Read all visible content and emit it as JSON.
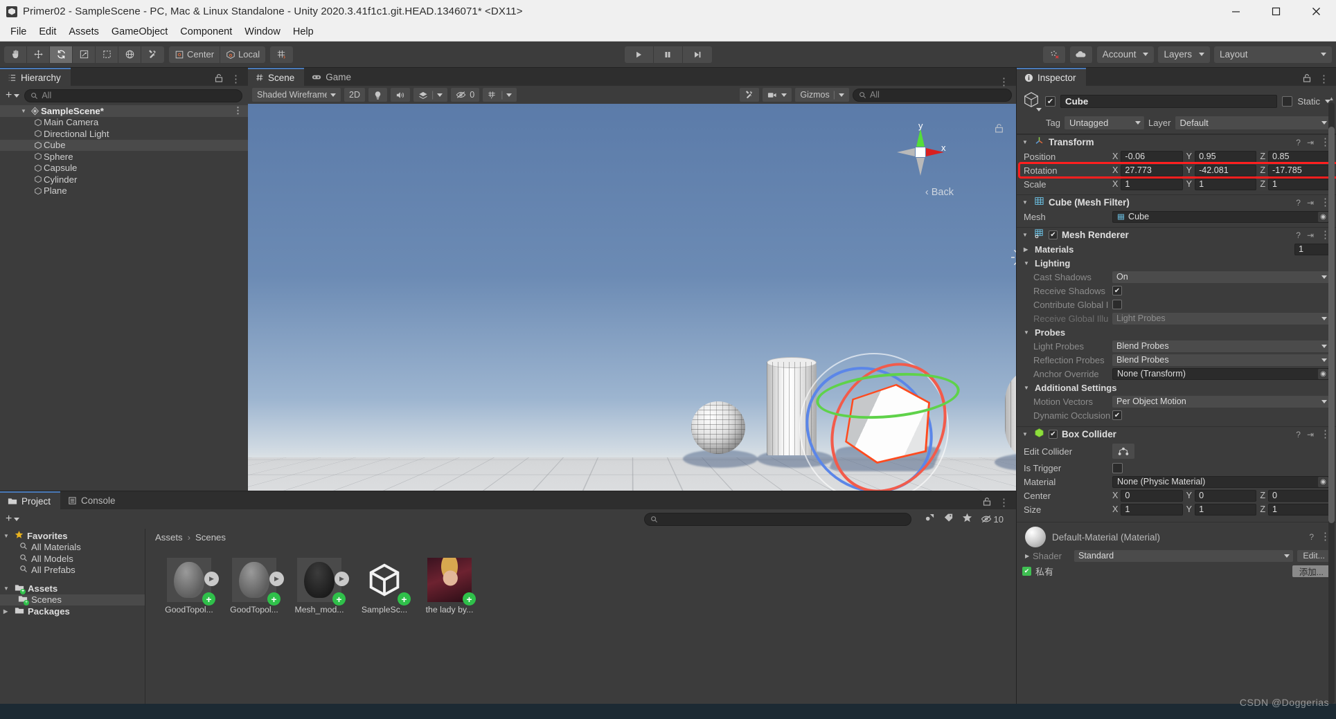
{
  "window": {
    "title": "Primer02 - SampleScene - PC, Mac & Linux Standalone - Unity 2020.3.41f1c1.git.HEAD.1346071* <DX11>",
    "icon": "unity-icon",
    "minimize": "minimize-icon",
    "maximize": "maximize-icon",
    "close": "close-icon"
  },
  "menubar": [
    "File",
    "Edit",
    "Assets",
    "GameObject",
    "Component",
    "Window",
    "Help"
  ],
  "toolbar": {
    "tools": [
      {
        "name": "hand-tool",
        "glyph": "hand",
        "active": false
      },
      {
        "name": "move-tool",
        "glyph": "move",
        "active": false
      },
      {
        "name": "rotate-tool",
        "glyph": "rotate",
        "active": true
      },
      {
        "name": "scale-tool",
        "glyph": "scale",
        "active": false
      },
      {
        "name": "rect-tool",
        "glyph": "rect",
        "active": false
      },
      {
        "name": "transform-tool",
        "glyph": "transform",
        "active": false
      },
      {
        "name": "custom-tool",
        "glyph": "wrench",
        "active": false
      }
    ],
    "pivot_mode": "Center",
    "pivot_rotation": "Local",
    "snap": "grid-snap-icon",
    "play": "play-icon",
    "pause": "pause-icon",
    "step": "step-icon",
    "collab": "collab-icon",
    "cloud": "cloud-icon",
    "account": "Account",
    "layers": "Layers",
    "layout": "Layout"
  },
  "hierarchy": {
    "tab": "Hierarchy",
    "search_placeholder": "All",
    "scene": "SampleScene*",
    "items": [
      {
        "label": "Main Camera",
        "selected": false
      },
      {
        "label": "Directional Light",
        "selected": false
      },
      {
        "label": "Cube",
        "selected": true
      },
      {
        "label": "Sphere",
        "selected": false
      },
      {
        "label": "Capsule",
        "selected": false
      },
      {
        "label": "Cylinder",
        "selected": false
      },
      {
        "label": "Plane",
        "selected": false
      }
    ]
  },
  "scene_view": {
    "tabs": [
      {
        "label": "Scene",
        "selected": true,
        "icon": "scene-icon"
      },
      {
        "label": "Game",
        "selected": false,
        "icon": "game-icon"
      }
    ],
    "draw_mode": "Shaded Wireframe",
    "mode_2d": "2D",
    "lighting": "lighting-icon",
    "audio": "audio-icon",
    "fx": "fx-icon",
    "hidden_count": "0",
    "grid": "grid-icon",
    "gizmos": "Gizmos",
    "search_placeholder": "All",
    "orientation_label": "Back",
    "axis_y": "y",
    "axis_x": "x",
    "lock": "lock-icon"
  },
  "project": {
    "tabs": [
      {
        "label": "Project",
        "selected": true,
        "icon": "folder-icon"
      },
      {
        "label": "Console",
        "selected": false,
        "icon": "console-icon"
      }
    ],
    "search_placeholder": "",
    "hidden_assets_count": "10",
    "tree": [
      {
        "label": "Favorites",
        "type": "star",
        "depth": 0,
        "expanded": true,
        "selected": false
      },
      {
        "label": "All Materials",
        "type": "search",
        "depth": 1,
        "selected": false
      },
      {
        "label": "All Models",
        "type": "search",
        "depth": 1,
        "selected": false
      },
      {
        "label": "All Prefabs",
        "type": "search",
        "depth": 1,
        "selected": false
      },
      {
        "label": "Assets",
        "type": "folder-add",
        "depth": 0,
        "expanded": true,
        "selected": false
      },
      {
        "label": "Scenes",
        "type": "folder-add",
        "depth": 1,
        "selected": true
      },
      {
        "label": "Packages",
        "type": "folder",
        "depth": 0,
        "expanded": false,
        "selected": false
      }
    ],
    "breadcrumb": [
      "Assets",
      "Scenes"
    ],
    "assets": [
      {
        "label": "GoodTopol...",
        "kind": "head",
        "play": true
      },
      {
        "label": "GoodTopol...",
        "kind": "head",
        "play": true
      },
      {
        "label": "Mesh_mod...",
        "kind": "head-dark",
        "play": true
      },
      {
        "label": "SampleSc...",
        "kind": "unity",
        "play": false
      },
      {
        "label": "the lady by...",
        "kind": "image",
        "play": false
      }
    ]
  },
  "inspector": {
    "tab": "Inspector",
    "object_name": "Cube",
    "enabled": true,
    "static_label": "Static",
    "tag_label": "Tag",
    "tag_value": "Untagged",
    "layer_label": "Layer",
    "layer_value": "Default",
    "components": [
      {
        "name": "Transform",
        "icon": "transform-icon",
        "rows": [
          {
            "label": "Position",
            "type": "vec3",
            "x": "-0.06",
            "y": "0.95",
            "z": "0.85"
          },
          {
            "label": "Rotation",
            "type": "vec3",
            "x": "27.773",
            "y": "-42.081",
            "z": "-17.785",
            "highlighted": true
          },
          {
            "label": "Scale",
            "type": "vec3",
            "x": "1",
            "y": "1",
            "z": "1"
          }
        ]
      },
      {
        "name": "Cube (Mesh Filter)",
        "icon": "mesh-filter-icon",
        "rows": [
          {
            "label": "Mesh",
            "type": "object",
            "value": "Cube"
          }
        ]
      },
      {
        "name": "Mesh Renderer",
        "icon": "mesh-renderer-icon",
        "checkbox": true,
        "rows": [
          {
            "label": "Materials",
            "type": "group-num",
            "value": "1"
          },
          {
            "label": "Lighting",
            "type": "group"
          },
          {
            "label": "Cast Shadows",
            "type": "dropdown",
            "value": "On",
            "indent": true
          },
          {
            "label": "Receive Shadows",
            "type": "check",
            "value": true,
            "indent": true
          },
          {
            "label": "Contribute Global I",
            "type": "check",
            "value": false,
            "indent": true
          },
          {
            "label": "Receive Global Illu",
            "type": "dropdown",
            "value": "Light Probes",
            "indent": true,
            "dim": true
          },
          {
            "label": "Probes",
            "type": "group"
          },
          {
            "label": "Light Probes",
            "type": "dropdown",
            "value": "Blend Probes",
            "indent": true
          },
          {
            "label": "Reflection Probes",
            "type": "dropdown",
            "value": "Blend Probes",
            "indent": true
          },
          {
            "label": "Anchor Override",
            "type": "object",
            "value": "None (Transform)",
            "indent": true
          },
          {
            "label": "Additional Settings",
            "type": "group"
          },
          {
            "label": "Motion Vectors",
            "type": "dropdown",
            "value": "Per Object Motion",
            "indent": true
          },
          {
            "label": "Dynamic Occlusion",
            "type": "check",
            "value": true,
            "indent": true
          }
        ]
      },
      {
        "name": "Box Collider",
        "icon": "box-collider-icon",
        "checkbox": true,
        "rows": [
          {
            "label": "Edit Collider",
            "type": "button",
            "value": "edit-collider-icon"
          },
          {
            "label": "Is Trigger",
            "type": "check",
            "value": false
          },
          {
            "label": "Material",
            "type": "object",
            "value": "None (Physic Material)"
          },
          {
            "label": "Center",
            "type": "vec3",
            "x": "0",
            "y": "0",
            "z": "0"
          },
          {
            "label": "Size",
            "type": "vec3",
            "x": "1",
            "y": "1",
            "z": "1"
          }
        ]
      }
    ],
    "material": {
      "title": "Default-Material (Material)",
      "shader_label": "Shader",
      "shader_value": "Standard",
      "edit_button": "Edit...",
      "private_label": "私有",
      "add_button": "添加..."
    }
  },
  "watermark": "CSDN @Doggerias",
  "colors": {
    "accent": "#4a7ab8",
    "highlight": "#ff1f1f",
    "axis_x": "#f25b4b",
    "axis_y": "#5fd24a",
    "axis_z": "#5b86e8",
    "selection_outline": "#ff4b1f",
    "panel_bg": "#3c3c3c",
    "toolbar_bg": "#3c3c3c"
  }
}
